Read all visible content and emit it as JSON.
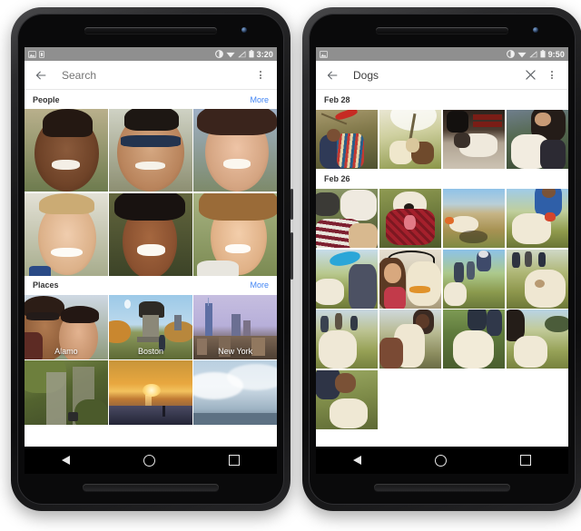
{
  "phones": [
    {
      "id": "left-phone",
      "status_bar": {
        "time": "3:20",
        "left_icons": [
          "photo-icon",
          "sim-icon"
        ],
        "right_icons": [
          "do-not-disturb-icon",
          "wifi-icon",
          "signal-off-icon",
          "battery-icon"
        ],
        "background": "#8f8f8f"
      },
      "app_bar": {
        "back_icon": "back-arrow-icon",
        "title": "Search",
        "title_is_placeholder": true,
        "overflow_icon": "overflow-menu-icon",
        "has_clear": false
      },
      "sections": [
        {
          "label": "People",
          "more_label": "More",
          "more_color": "#4285f4",
          "columns": 3,
          "tiles": [
            {
              "caption": "",
              "name": "photo-person-1"
            },
            {
              "caption": "",
              "name": "photo-person-2"
            },
            {
              "caption": "",
              "name": "photo-person-3"
            },
            {
              "caption": "",
              "name": "photo-person-4"
            },
            {
              "caption": "",
              "name": "photo-person-5"
            },
            {
              "caption": "",
              "name": "photo-person-6"
            }
          ]
        },
        {
          "label": "Places",
          "more_label": "More",
          "more_color": "#4285f4",
          "columns": 3,
          "tiles": [
            {
              "caption": "Alamo",
              "name": "photo-place-alamo"
            },
            {
              "caption": "Boston",
              "name": "photo-place-boston"
            },
            {
              "caption": "New York",
              "name": "photo-place-new-york"
            },
            {
              "caption": "",
              "name": "photo-place-4"
            },
            {
              "caption": "",
              "name": "photo-place-5"
            },
            {
              "caption": "",
              "name": "photo-place-6"
            }
          ]
        }
      ],
      "nav_bar": {
        "back": "nav-back-icon",
        "home": "nav-home-icon",
        "recents": "nav-recents-icon"
      }
    },
    {
      "id": "right-phone",
      "status_bar": {
        "time": "9:50",
        "left_icons": [
          "photo-icon"
        ],
        "right_icons": [
          "do-not-disturb-icon",
          "wifi-icon",
          "signal-off-icon",
          "battery-icon"
        ],
        "background": "#8f8f8f"
      },
      "app_bar": {
        "back_icon": "back-arrow-icon",
        "title": "Dogs",
        "title_is_placeholder": false,
        "clear_icon": "clear-x-icon",
        "overflow_icon": "overflow-menu-icon",
        "has_clear": true
      },
      "date_groups": [
        {
          "label": "Feb 28",
          "columns": 4,
          "tiles": [
            {
              "name": "photo-dog-1"
            },
            {
              "name": "photo-dog-2"
            },
            {
              "name": "photo-dog-3"
            },
            {
              "name": "photo-dog-4"
            }
          ]
        },
        {
          "label": "Feb 26",
          "columns": 4,
          "tiles": [
            {
              "name": "photo-dog-5"
            },
            {
              "name": "photo-dog-6"
            },
            {
              "name": "photo-dog-7"
            },
            {
              "name": "photo-dog-8"
            },
            {
              "name": "photo-dog-9"
            },
            {
              "name": "photo-dog-10"
            },
            {
              "name": "photo-dog-11"
            },
            {
              "name": "photo-dog-12"
            },
            {
              "name": "photo-dog-13"
            },
            {
              "name": "photo-dog-14"
            },
            {
              "name": "photo-dog-15"
            },
            {
              "name": "photo-dog-16"
            },
            {
              "name": "photo-dog-17"
            }
          ]
        }
      ],
      "nav_bar": {
        "back": "nav-back-icon",
        "home": "nav-home-icon",
        "recents": "nav-recents-icon"
      }
    }
  ],
  "theme": {
    "page_background": "#ffffff",
    "app_bar_background": "#ffffff",
    "accent": "#4285f4",
    "status_bar_background": "#8f8f8f",
    "nav_bar_background": "#000000",
    "title_placeholder_color": "#757575",
    "section_label_color": "#333333"
  }
}
